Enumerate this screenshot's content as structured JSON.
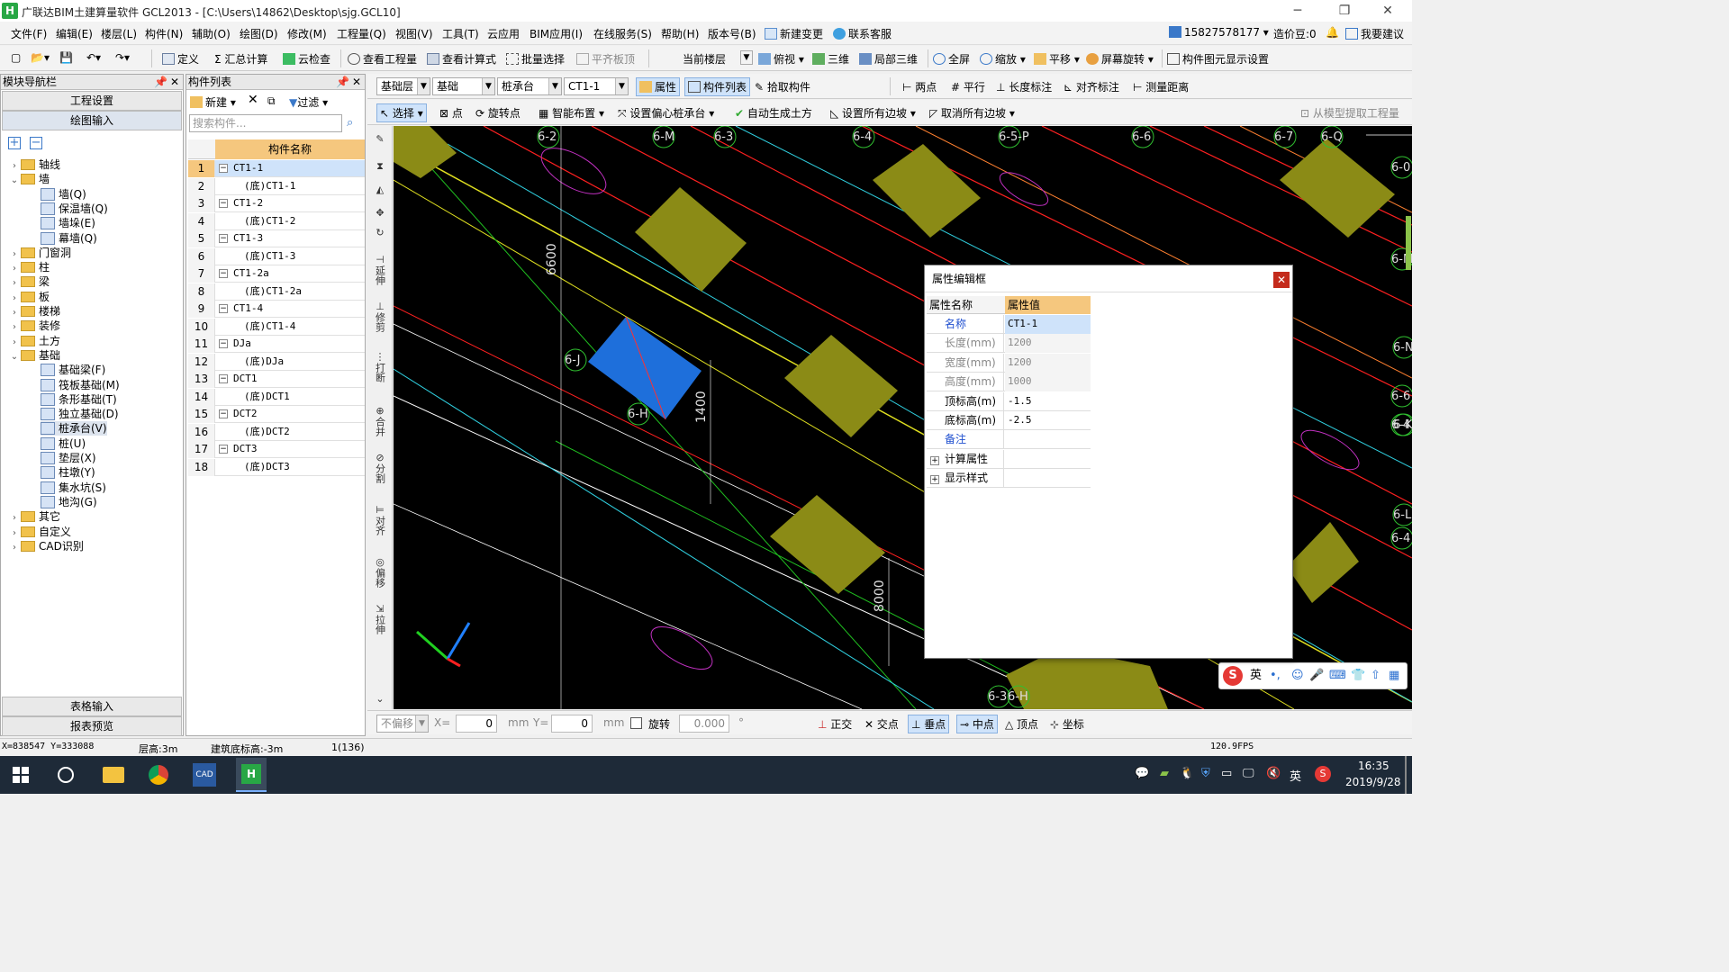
{
  "window": {
    "title": "广联达BIM土建算量软件 GCL2013 - [C:\\Users\\14862\\Desktop\\sjg.GCL10]",
    "app_icon": "H"
  },
  "menu": [
    "文件(F)",
    "编辑(E)",
    "楼层(L)",
    "构件(N)",
    "辅助(O)",
    "绘图(D)",
    "修改(M)",
    "工程量(Q)",
    "视图(V)",
    "工具(T)",
    "云应用",
    "BIM应用(I)",
    "在线服务(S)",
    "帮助(H)",
    "版本号(B)",
    "新建变更",
    "联系客服"
  ],
  "account": {
    "phone": "15827578177",
    "cost_beans": "造价豆:0",
    "suggest": "我要建议"
  },
  "toolbar1": [
    "定义",
    "汇总计算",
    "云检查",
    "查看工程量",
    "查看计算式",
    "批量选择",
    "平齐板顶",
    "当前楼层",
    "俯视",
    "三维",
    "局部三维",
    "全屏",
    "缩放",
    "平移",
    "屏幕旋转",
    "构件图元显示设置"
  ],
  "left_panel": {
    "header": "模块导航栏",
    "btn_project": "工程设置",
    "btn_draw": "绘图输入",
    "btn_table": "表格输入",
    "btn_report": "报表预览",
    "tree": [
      {
        "label": "轴线",
        "level": 0,
        "exp": "+",
        "type": "folder"
      },
      {
        "label": "墙",
        "level": 0,
        "exp": "−",
        "type": "folder"
      },
      {
        "label": "墙(Q)",
        "level": 1,
        "type": "comp"
      },
      {
        "label": "保温墙(Q)",
        "level": 1,
        "type": "comp"
      },
      {
        "label": "墙垛(E)",
        "level": 1,
        "type": "comp"
      },
      {
        "label": "幕墙(Q)",
        "level": 1,
        "type": "comp"
      },
      {
        "label": "门窗洞",
        "level": 0,
        "exp": "+",
        "type": "folder"
      },
      {
        "label": "柱",
        "level": 0,
        "exp": "+",
        "type": "folder"
      },
      {
        "label": "梁",
        "level": 0,
        "exp": "+",
        "type": "folder"
      },
      {
        "label": "板",
        "level": 0,
        "exp": "+",
        "type": "folder"
      },
      {
        "label": "楼梯",
        "level": 0,
        "exp": "+",
        "type": "folder"
      },
      {
        "label": "装修",
        "level": 0,
        "exp": "+",
        "type": "folder"
      },
      {
        "label": "土方",
        "level": 0,
        "exp": "+",
        "type": "folder"
      },
      {
        "label": "基础",
        "level": 0,
        "exp": "−",
        "type": "folder"
      },
      {
        "label": "基础梁(F)",
        "level": 1,
        "type": "comp"
      },
      {
        "label": "筏板基础(M)",
        "level": 1,
        "type": "comp"
      },
      {
        "label": "条形基础(T)",
        "level": 1,
        "type": "comp"
      },
      {
        "label": "独立基础(D)",
        "level": 1,
        "type": "comp"
      },
      {
        "label": "桩承台(V)",
        "level": 1,
        "type": "comp",
        "selected": true
      },
      {
        "label": "桩(U)",
        "level": 1,
        "type": "comp"
      },
      {
        "label": "垫层(X)",
        "level": 1,
        "type": "comp"
      },
      {
        "label": "柱墩(Y)",
        "level": 1,
        "type": "comp"
      },
      {
        "label": "集水坑(S)",
        "level": 1,
        "type": "comp"
      },
      {
        "label": "地沟(G)",
        "level": 1,
        "type": "comp"
      },
      {
        "label": "其它",
        "level": 0,
        "exp": "+",
        "type": "folder"
      },
      {
        "label": "自定义",
        "level": 0,
        "exp": "+",
        "type": "folder"
      },
      {
        "label": "CAD识别",
        "level": 0,
        "exp": "+",
        "type": "folder"
      }
    ]
  },
  "list_panel": {
    "header": "构件列表",
    "new_btn": "新建",
    "filter_btn": "过滤",
    "search_placeholder": "搜索构件...",
    "col_header": "构件名称",
    "rows": [
      {
        "n": "1",
        "name": "CT1-1",
        "child": false
      },
      {
        "n": "2",
        "name": "(底)CT1-1",
        "child": true
      },
      {
        "n": "3",
        "name": "CT1-2",
        "child": false
      },
      {
        "n": "4",
        "name": "(底)CT1-2",
        "child": true
      },
      {
        "n": "5",
        "name": "CT1-3",
        "child": false
      },
      {
        "n": "6",
        "name": "(底)CT1-3",
        "child": true
      },
      {
        "n": "7",
        "name": "CT1-2a",
        "child": false
      },
      {
        "n": "8",
        "name": "(底)CT1-2a",
        "child": true
      },
      {
        "n": "9",
        "name": "CT1-4",
        "child": false
      },
      {
        "n": "10",
        "name": "(底)CT1-4",
        "child": true
      },
      {
        "n": "11",
        "name": "DJa",
        "child": false
      },
      {
        "n": "12",
        "name": "(底)DJa",
        "child": true
      },
      {
        "n": "13",
        "name": "DCT1",
        "child": false
      },
      {
        "n": "14",
        "name": "(底)DCT1",
        "child": true
      },
      {
        "n": "15",
        "name": "DCT2",
        "child": false
      },
      {
        "n": "16",
        "name": "(底)DCT2",
        "child": true
      },
      {
        "n": "17",
        "name": "DCT3",
        "child": false
      },
      {
        "n": "18",
        "name": "(底)DCT3",
        "child": true
      }
    ]
  },
  "cad_toolbar1": {
    "floor_type": "基础层",
    "floor": "基础",
    "comp_type": "桩承台",
    "comp": "CT1-1",
    "buttons": [
      "属性",
      "构件列表",
      "拾取构件",
      "两点",
      "平行",
      "长度标注",
      "对齐标注",
      "测量距离"
    ]
  },
  "cad_toolbar2": [
    "选择",
    "点",
    "旋转点",
    "智能布置",
    "设置偏心桩承台",
    "自动生成土方",
    "设置所有边坡",
    "取消所有边坡",
    "从模型提取工程量"
  ],
  "vtools": [
    "延伸",
    "修剪",
    "打断",
    "合并",
    "分割",
    "对齐",
    "偏移",
    "拉伸"
  ],
  "axis_labels": [
    "6-2",
    "6-M",
    "6-3",
    "6-4",
    "6-5-P",
    "6-6",
    "6-7",
    "6-Q",
    "6-0",
    "6-N",
    "6-M",
    "6-L",
    "6-K",
    "6-J",
    "6-H",
    "6-3",
    "6-H",
    "6-6",
    "6-4",
    "6-4"
  ],
  "dimensions": [
    "6600",
    "1400",
    "8000"
  ],
  "bottombar": {
    "mode": "不偏移",
    "x_label": "X=",
    "x_val": "0",
    "mm": "mm",
    "y_label": "Y=",
    "y_val": "0",
    "mm2": "mm",
    "rotate_label": "旋转",
    "rotate_val": "0.000",
    "deg": "°",
    "snaps": [
      "正交",
      "交点",
      "垂点",
      "中点",
      "顶点",
      "坐标"
    ]
  },
  "status": {
    "coords": "X=838547 Y=333088",
    "floor_height": "层高:3m",
    "base_elev": "建筑底标高:-3m",
    "count": "1(136)",
    "fps": "120.9FPS"
  },
  "prop_dialog": {
    "title": "属性编辑框",
    "col_name": "属性名称",
    "col_value": "属性值",
    "rows": [
      {
        "name": "名称",
        "value": "CT1-1",
        "style": "blue"
      },
      {
        "name": "长度(mm)",
        "value": "1200",
        "style": "gray"
      },
      {
        "name": "宽度(mm)",
        "value": "1200",
        "style": "gray"
      },
      {
        "name": "高度(mm)",
        "value": "1000",
        "style": "gray"
      },
      {
        "name": "顶标高(m)",
        "value": "-1.5",
        "style": "normal"
      },
      {
        "name": "底标高(m)",
        "value": "-2.5",
        "style": "normal"
      },
      {
        "name": "备注",
        "value": "",
        "style": "blue"
      },
      {
        "name": "计算属性",
        "value": "",
        "style": "group"
      },
      {
        "name": "显示样式",
        "value": "",
        "style": "group"
      }
    ]
  },
  "taskbar": {
    "ime": "英",
    "time": "16:35",
    "date": "2019/9/28",
    "ime2": "英"
  },
  "colors": {
    "accent": "#0078d7",
    "selected": "#cfe3fa",
    "column_header": "#f5c77e",
    "cad_bg": "#000000",
    "pile_cap": "#8b8b16",
    "pile_cap_sel": "#1e6fdb"
  }
}
